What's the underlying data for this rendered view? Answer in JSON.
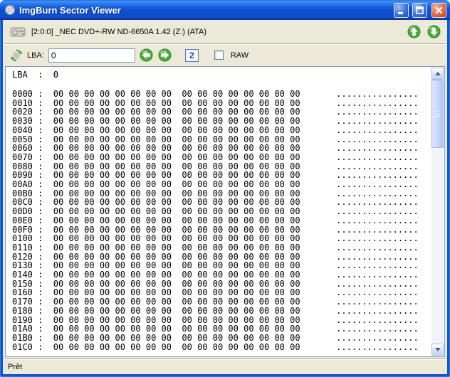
{
  "window": {
    "title": "ImgBurn Sector Viewer"
  },
  "device_bar": {
    "device": "[2:0:0] _NEC DVD+-RW ND-6650A 1.42 (Z:) (ATA)"
  },
  "lba_bar": {
    "label": "LBA:",
    "value": "0",
    "sector_size_button": "2",
    "raw_label": "RAW",
    "raw_checked": false
  },
  "hex_view": {
    "header": "LBA  :  0",
    "row_hex": "00 00 00 00 00 00 00 00  00 00 00 00 00 00 00 00",
    "row_ascii": "................",
    "row_addresses": [
      "0000",
      "0010",
      "0020",
      "0030",
      "0040",
      "0050",
      "0060",
      "0070",
      "0080",
      "0090",
      "00A0",
      "00B0",
      "00C0",
      "00D0",
      "00E0",
      "00F0",
      "0100",
      "0110",
      "0120",
      "0130",
      "0140",
      "0150",
      "0160",
      "0170",
      "0180",
      "0190",
      "01A0",
      "01B0",
      "01C0"
    ]
  },
  "status_bar": {
    "text": "Prêt"
  },
  "colors": {
    "titlebar_blue": "#0F52D2",
    "window_frame": "#0C56CE",
    "body_tan": "#ECE9D8",
    "green_button": "#4CAF3F",
    "close_red": "#C33B0F"
  }
}
